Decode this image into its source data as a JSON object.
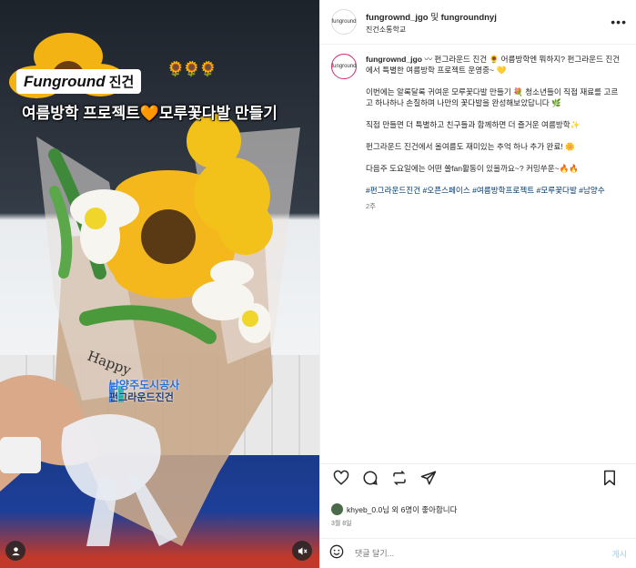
{
  "media": {
    "brand_en": "Funground",
    "brand_ko": "진건",
    "sunflowers": "🌻🌻🌻",
    "headline_a": "여름방학 프로젝트",
    "headline_heart": "🧡",
    "headline_b": "모루꽃다발 만들기",
    "logo_line1": "남양주도시공사",
    "logo_line2": "펀그라운드진건",
    "user_icon": "user-tag-icon",
    "mute_icon": "muted-speaker-icon"
  },
  "header": {
    "avatar_text": "funground",
    "account": "fungrownd_jgo",
    "joiner": "및",
    "collab": "fungroundnyj",
    "location": "진건소통학교"
  },
  "caption": {
    "avatar_text": "funground",
    "username": "fungrownd_jgo",
    "intro": "〰 펀그라운드 진건 🌻 어름방학엔 뭐하지? 펀그라운드 진건에서 특별한 여름방학 프로젝트 운영중~ 💛",
    "para1": "이번에는 알록달록 귀여운 모루꽃다발 만들기 💐 청소년들이 직접 재료를 고르고 하나하나 손질하며 나만의 꽃다발을 완성해보았답니다 🌿",
    "para2": "직접 만들면 더 특별하고 친구들과 함께하면 더 즐거운 여름방학✨",
    "para3": "펀그라운드 진건에서 올여름도 재미있는 추억 하나 추가 완료! 🌼",
    "para4": "다음주 도요일에는 어떤 쏠fan활동이 있을까요~? 커밍쑤운~🔥🔥",
    "hashtags": "#펀그라운드진건 #오픈스페이스 #여름방학프로젝트 #모루꽃다발 #남양수",
    "time": "2주"
  },
  "actions": {
    "like": "♡",
    "comment": "◯",
    "share": "⇄",
    "send": "➤",
    "save": "🔖"
  },
  "likes": {
    "text": "khyeb_0.0님 외 6명이 좋아합니다"
  },
  "date": "3월 8일",
  "comment": {
    "emoji": "☺",
    "placeholder": "댓글 달기...",
    "post_label": "게시"
  }
}
